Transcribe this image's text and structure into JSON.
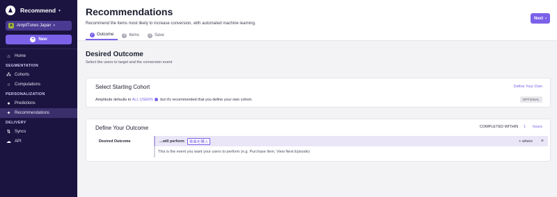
{
  "sidebar": {
    "brand": "Recommend",
    "org": {
      "avatar_letter": "A",
      "name": "AmpliTunes Japan"
    },
    "new_label": "New",
    "home": "Home",
    "sections": {
      "segmentation": "SEGMENTATION",
      "personalization": "PERSONALIZATION",
      "delivery": "DELIVERY"
    },
    "items": {
      "cohorts": "Cohorts",
      "computations": "Computations",
      "predictions": "Predictions",
      "recommendations": "Recommendations",
      "syncs": "Syncs",
      "api": "API"
    }
  },
  "header": {
    "title": "Recommendations",
    "subtitle": "Recommend the items most likely to increase conversion, with automated machine learning.",
    "tabs": [
      {
        "label": "Outcome",
        "icon": "✓"
      },
      {
        "label": "Items",
        "icon": "2"
      },
      {
        "label": "Save",
        "icon": "3"
      }
    ]
  },
  "outcome_section": {
    "title": "Desired Outcome",
    "subtitle": "Select the users to target and the conversion event",
    "next_label": "Next"
  },
  "cohort_card": {
    "title": "Select Starting Cohort",
    "link": "Define Your Own",
    "text_before": "Amplitude defaults to",
    "all_users": "ALL USERS",
    "text_after": "but it's recommended that you define your own cohort.",
    "badge": "OPTIONAL"
  },
  "outcome_card": {
    "title": "Define Your Outcome",
    "completed_label": "COMPLETED WITHIN",
    "completed_value": "1",
    "completed_unit": "hours",
    "row_label": "Desired Outcome",
    "perform_text": "...will perform",
    "event": "楽曲を購入",
    "where_label": "+ where",
    "close": "×",
    "hint": "This is the event you want your users to perform (e.g. Purchase Item, View Next Episode)"
  },
  "colors": {
    "sidebar": "#1b1340",
    "accent": "#7b61e8"
  }
}
